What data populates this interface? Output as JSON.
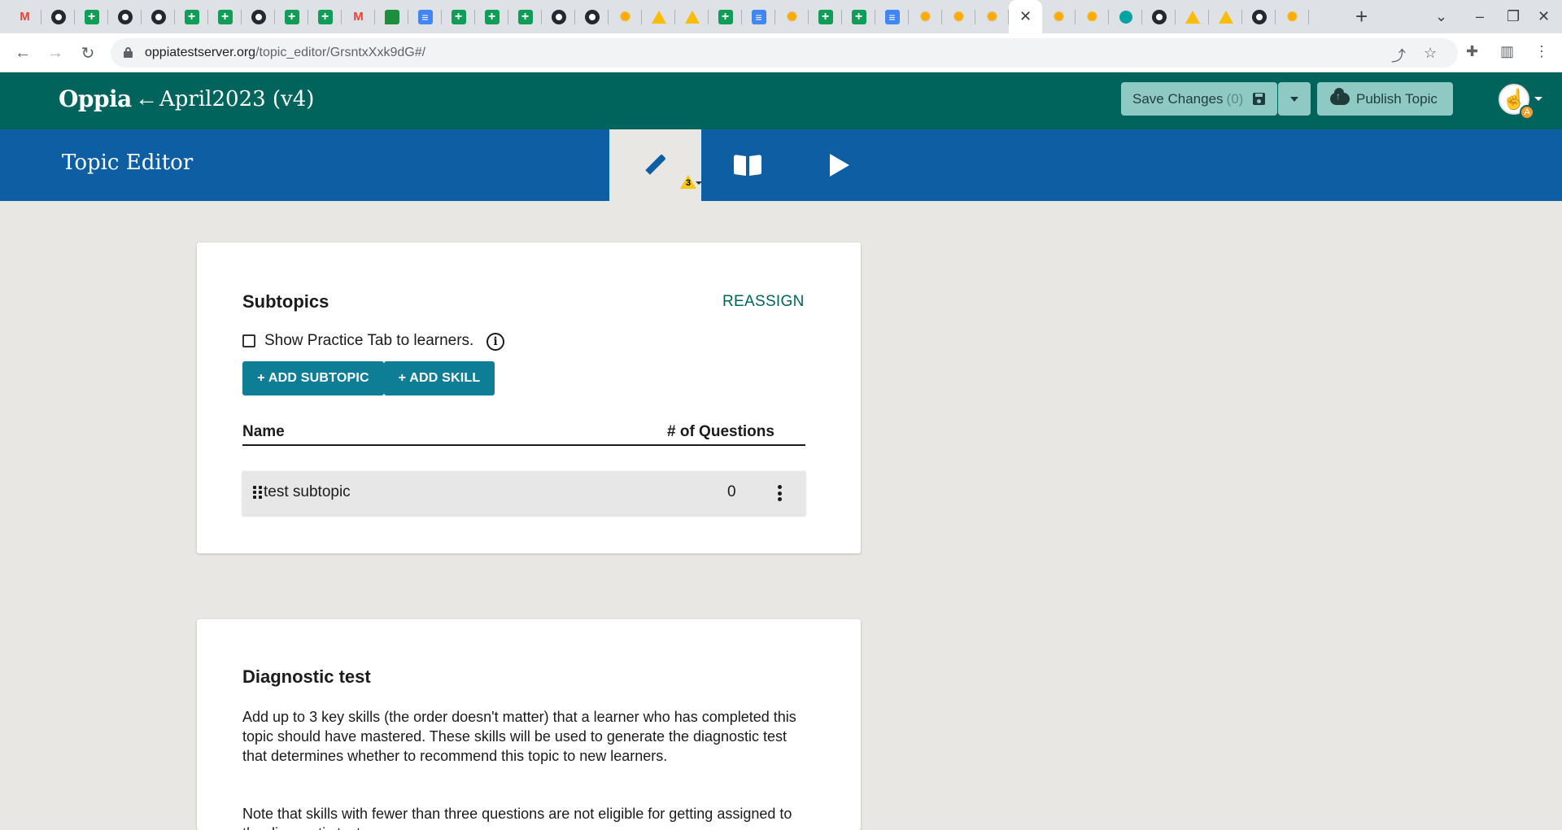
{
  "browser": {
    "tabs": [
      "gmail",
      "github",
      "sheets",
      "github",
      "github",
      "sheets",
      "sheets",
      "github",
      "sheets",
      "sheets",
      "gmail",
      "chat",
      "docs",
      "sheets",
      "sheets",
      "sheets",
      "github",
      "github",
      "bulb",
      "drive",
      "drive",
      "sheets",
      "docs",
      "bulb",
      "sheets",
      "sheets",
      "docs",
      "bulb",
      "bulb",
      "bulb",
      "close",
      "bulb",
      "bulb",
      "circle",
      "github",
      "drive",
      "drive",
      "github",
      "bulb"
    ],
    "active_tab_index": 30,
    "url_domain": "oppiatestserver.org",
    "url_path": "/topic_editor/GrsntxXxk9dG#/"
  },
  "navbar": {
    "logo": "Oppia",
    "topic_name": "April2023 (v4)",
    "save_label": "Save Changes",
    "save_count": "(0)",
    "publish_label": "Publish Topic",
    "avatar_badge": "A"
  },
  "editor": {
    "title": "Topic Editor",
    "warning_count": "3"
  },
  "subtopics": {
    "title": "Subtopics",
    "reassign": "REASSIGN",
    "practice_label": "Show Practice Tab to learners.",
    "add_subtopic": "+ ADD SUBTOPIC",
    "add_skill": "+ ADD SKILL",
    "col_name": "Name",
    "col_questions": "# of Questions",
    "rows": [
      {
        "name": "test subtopic",
        "questions": "0"
      }
    ]
  },
  "diagnostic": {
    "title": "Diagnostic test",
    "para1": "Add up to 3 key skills (the order doesn't matter) that a learner who has completed this topic should have mastered. These skills will be used to generate the diagnostic test that determines whether to recommend this topic to new learners.",
    "para2": "Note that skills with fewer than three questions are not eligible for getting assigned to the diagnostic test."
  },
  "colors": {
    "navbar": "#00645c",
    "editorbar": "#0d5ea3",
    "button": "#0d7e96",
    "page_bg": "#e8e7e3"
  }
}
